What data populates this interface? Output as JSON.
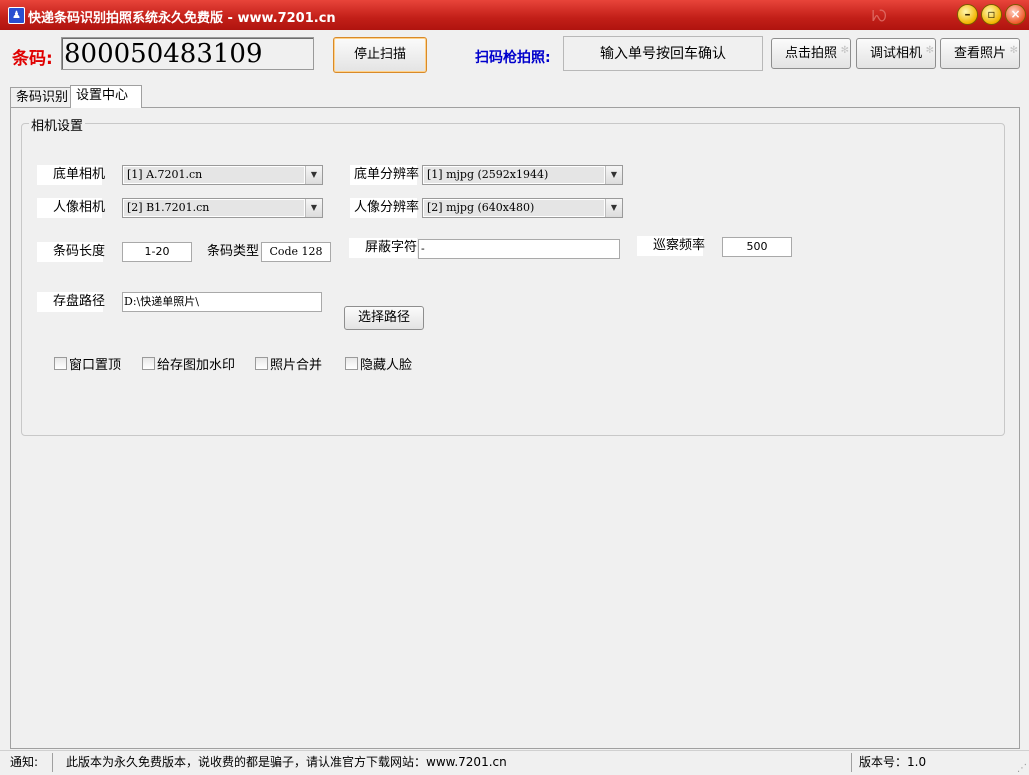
{
  "window": {
    "title": "快递条码识别拍照系统永久免费版  -  www.7201.cn"
  },
  "header": {
    "barcode_label": "条码:",
    "barcode_value": "800050483109",
    "stop_scan": "停止扫描",
    "scan_photo_label": "扫码枪拍照:",
    "scan_hint": "输入单号按回车确认",
    "take_photo": "点击拍照",
    "debug_camera": "调试相机",
    "view_photos": "查看照片"
  },
  "tabs": [
    {
      "label": "条码识别"
    },
    {
      "label": "设置中心"
    }
  ],
  "camera_settings": {
    "group_title": "相机设置",
    "waybill_camera_label": "底单相机",
    "waybill_camera_value": "[1] A.7201.cn",
    "waybill_resolution_label": "底单分辨率",
    "waybill_resolution_value": "[1] mjpg (2592x1944)",
    "portrait_camera_label": "人像相机",
    "portrait_camera_value": "[2] B1.7201.cn",
    "portrait_resolution_label": "人像分辨率",
    "portrait_resolution_value": "[2] mjpg (640x480)",
    "barcode_length_label": "条码长度",
    "barcode_length_value": "1-20",
    "barcode_type_label": "条码类型",
    "barcode_type_value": "Code 128",
    "mask_chars_label": "屏蔽字符",
    "mask_chars_value": "-",
    "patrol_rate_label": "巡察频率",
    "patrol_rate_value": "500",
    "save_path_label": "存盘路径",
    "save_path_value": "D:\\快递单照片\\",
    "choose_path": "选择路径",
    "checkboxes": [
      {
        "label": "窗口置顶",
        "checked": false
      },
      {
        "label": "给存图加水印",
        "checked": false
      },
      {
        "label": "照片合并",
        "checked": false
      },
      {
        "label": "隐藏人脸",
        "checked": false
      }
    ]
  },
  "statusbar": {
    "notice_label": "通知:",
    "notice_text": "此版本为永久免费版本，说收费的都是骗子，请认准官方下载网站：www.7201.cn",
    "version": "版本号：1.0"
  },
  "colors": {
    "titlebar": "#c21f18",
    "barcode_label": "#e00000",
    "scan_label": "#0000cc"
  }
}
